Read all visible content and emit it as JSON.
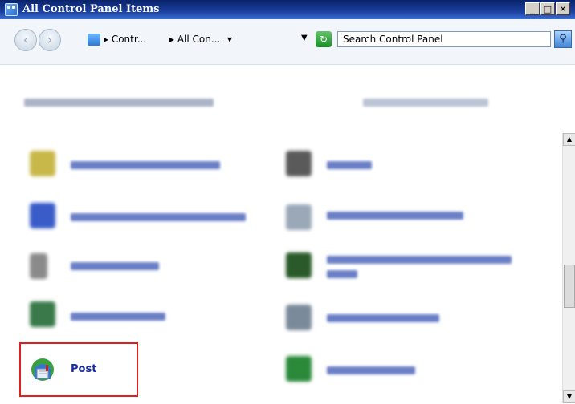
{
  "window": {
    "title": "All Control Panel Items",
    "min_label": "_",
    "max_label": "□",
    "close_label": "✕"
  },
  "address": {
    "back": "‹",
    "forward": "›",
    "crumb1": "▸ Contr...",
    "crumb2": "▸ All Con...",
    "crumb3": "▾",
    "refresh": "↻"
  },
  "search": {
    "value": "Search Control Panel",
    "icon": "search-icon"
  },
  "main": {
    "post_item_label": "Post"
  },
  "scrollbar": {
    "up": "▲",
    "down": "▼"
  },
  "colors": {
    "title_bar": "#0a246a",
    "highlight_border": "#e02020",
    "link_color": "#1a2ca0"
  }
}
